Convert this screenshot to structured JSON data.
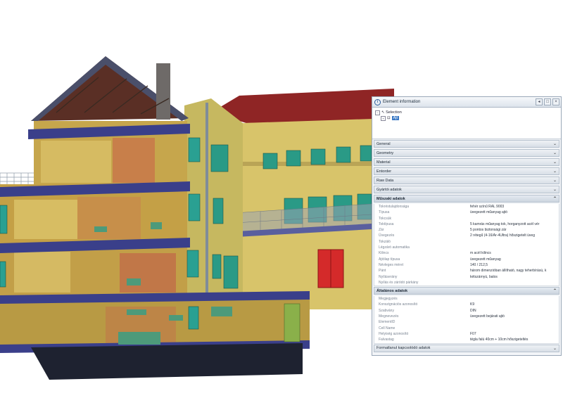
{
  "panel": {
    "title": "Element information",
    "window_buttons": [
      "◂",
      "□",
      "×"
    ],
    "tree": {
      "root_label": "Selection",
      "child_label": "Ajt"
    },
    "sections_top": [
      {
        "label": "General"
      },
      {
        "label": "Geometry"
      },
      {
        "label": "Material"
      },
      {
        "label": "Entorder"
      },
      {
        "label": "Raw Data"
      },
      {
        "label": "Gyártói adatok"
      }
    ],
    "section_muszaki": {
      "label": "Műszaki adatok",
      "rows": [
        {
          "k": "Tokréstulajdonsága",
          "v": "fehér színű RAL 9003"
        },
        {
          "k": "Típusa",
          "v": "üvegezett műanyag ajtó"
        },
        {
          "k": "Tokcsük",
          "v": ""
        },
        {
          "k": "Toktípusa",
          "v": "5 kamrás műanyag tok, horganyzott acél vér"
        },
        {
          "k": "Zár",
          "v": "5 pontos biztonsági zár"
        },
        {
          "k": "Üvegezés",
          "v": "2 rétegű (4-16/Ar-4Ultra) hőszigetelt üveg"
        },
        {
          "k": "Tokzáló",
          "v": ""
        },
        {
          "k": "Légzáró automatika",
          "v": ""
        },
        {
          "k": "Kilincs",
          "v": "m acél kilincs"
        },
        {
          "k": "Ajtólap típusa",
          "v": "üvegezett műanyag"
        },
        {
          "k": "Névleges méret",
          "v": "140 / 212,5"
        },
        {
          "k": "Pánt",
          "v": "három dimenzióban állítható, nagy teherbírású, k"
        },
        {
          "k": "Nyíláserány",
          "v": "kétszárnyú, balos"
        },
        {
          "k": "Nyílás és záródó párkány",
          "v": ""
        }
      ]
    },
    "section_altalanos": {
      "label": "Általános adatok",
      "rows": [
        {
          "k": "Megjegyzés",
          "v": ""
        },
        {
          "k": "Konszignációs azonosító",
          "v": "K9"
        },
        {
          "k": "Szabvány",
          "v": "DIN"
        },
        {
          "k": "Megnevezés",
          "v": "üvegezett bejárati ajtó"
        },
        {
          "k": "ElementID",
          "v": ""
        },
        {
          "k": "Cell Name",
          "v": ""
        },
        {
          "k": "Helyiség azonosító",
          "v": "F07"
        },
        {
          "k": "Falvastag",
          "v": "tégla falú 40cm + 10cm hőszigeteltés"
        }
      ]
    },
    "section_bottom": {
      "label": "Formatlanul kapcsolódó adatok"
    },
    "chevron_closed": "⌄",
    "chevron_open": "⌃"
  }
}
